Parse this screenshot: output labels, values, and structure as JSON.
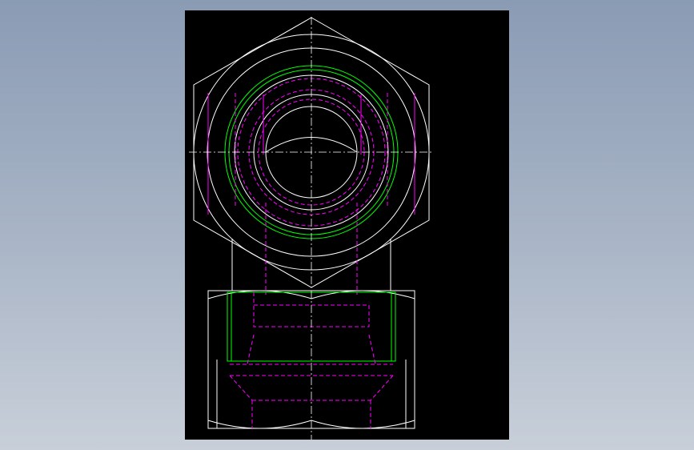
{
  "background": {
    "gradient_top": "#8a9bb4",
    "gradient_bottom": "#c8cfd9"
  },
  "viewport": {
    "background": "#000000"
  },
  "drawing": {
    "colors": {
      "outline": "#ffffff",
      "hidden": "#ff00ff",
      "thread": "#00ff00",
      "centerline": "#ffffff"
    },
    "views": [
      "top-view-hex-nut",
      "front-view-hex-nut"
    ]
  }
}
